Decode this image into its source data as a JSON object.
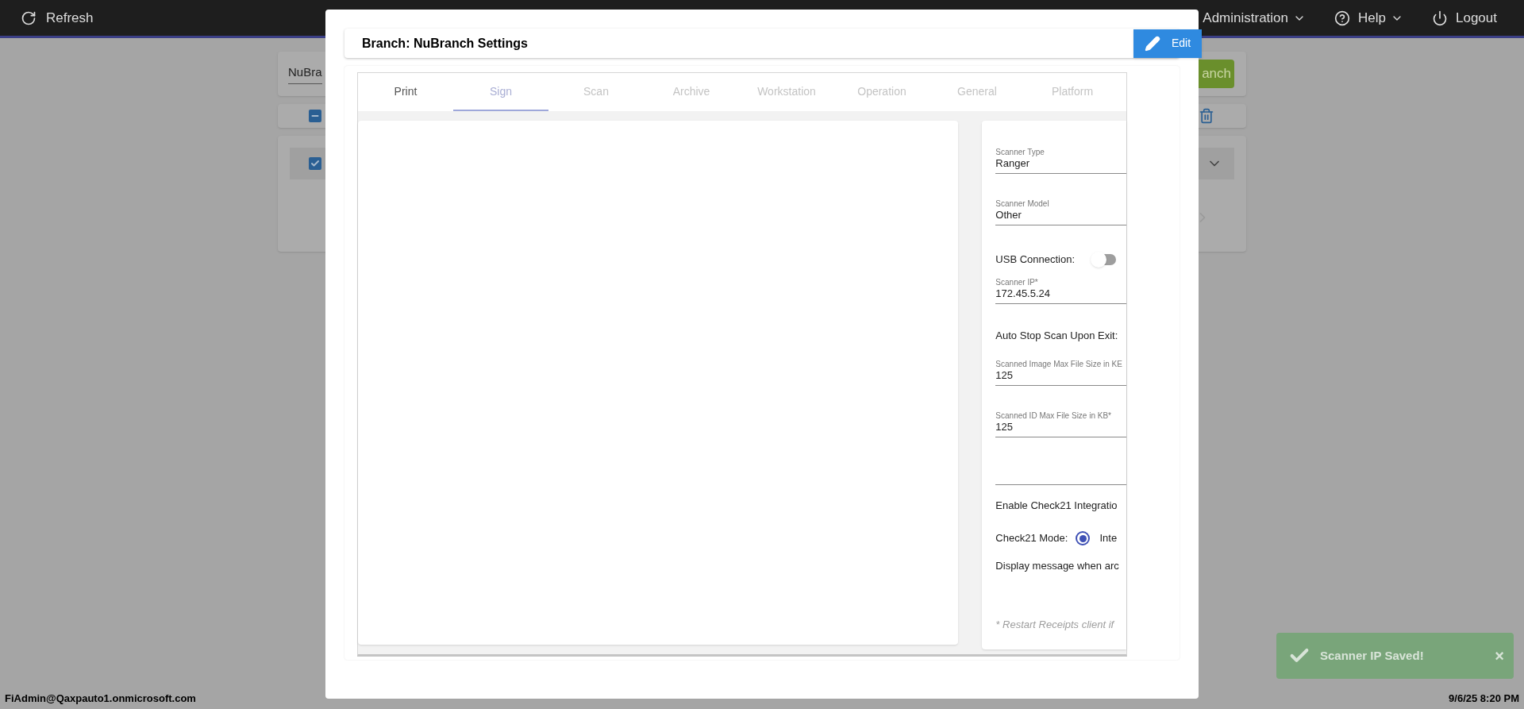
{
  "top_bar": {
    "refresh": "Refresh",
    "menus": [
      {
        "label": "Administration",
        "kind": "dropdown"
      },
      {
        "label": "Help",
        "kind": "help"
      },
      {
        "label": "Logout",
        "kind": "logout"
      }
    ]
  },
  "background": {
    "branch_field": "NuBra",
    "branch_button": "anch",
    "select_all": {
      "kind": "partial"
    },
    "row_checkbox": {
      "checked": true
    }
  },
  "modal": {
    "title": "Branch: NuBranch Settings",
    "edit_button": "Edit",
    "tabs": [
      {
        "label": "Print",
        "selected": false,
        "disabled": false
      },
      {
        "label": "Sign",
        "selected": true,
        "disabled": false
      },
      {
        "label": "Scan",
        "selected": false,
        "disabled": true
      },
      {
        "label": "Archive",
        "selected": false,
        "disabled": true
      },
      {
        "label": "Workstation",
        "selected": false,
        "disabled": true
      },
      {
        "label": "Operation",
        "selected": false,
        "disabled": true
      },
      {
        "label": "General",
        "selected": false,
        "disabled": true
      },
      {
        "label": "Platform",
        "selected": false,
        "disabled": true
      }
    ],
    "fields": [
      {
        "kind": "select",
        "label": "Scanner Type",
        "value": "Ranger"
      },
      {
        "kind": "select",
        "label": "Scanner Model",
        "value": "Other"
      },
      {
        "kind": "toggle",
        "label": "USB Connection:",
        "on": false
      },
      {
        "kind": "input",
        "label": "Scanner IP*",
        "value": "172.45.5.24"
      },
      {
        "kind": "text",
        "label": "Auto Stop Scan Upon Exit:"
      },
      {
        "kind": "input",
        "label": "Scanned Image Max File Size in KE",
        "value": "125"
      },
      {
        "kind": "input",
        "label": "Scanned ID Max File Size in KB*",
        "value": "125"
      },
      {
        "kind": "blank"
      },
      {
        "kind": "text",
        "label": "Enable Check21 Integratio"
      },
      {
        "kind": "radio",
        "label": "Check21 Mode:",
        "option": "Inte",
        "selected": true
      },
      {
        "kind": "text",
        "label": "Display message when arc"
      },
      {
        "kind": "note",
        "label": "* Restart Receipts client if"
      }
    ]
  },
  "status_bar": {
    "user": "FiAdmin@Qaxpauto1.onmicrosoft.com",
    "datetime": "9/6/25 8:20 PM"
  },
  "toast": {
    "message": "Scanner IP Saved!",
    "close": "×"
  }
}
